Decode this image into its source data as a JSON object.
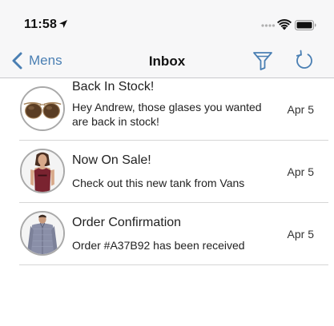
{
  "status_bar": {
    "time": "11:58",
    "icons": [
      "location-arrow-icon",
      "cellular-signal-icon",
      "wifi-icon",
      "battery-icon"
    ]
  },
  "nav": {
    "back_label": "Mens",
    "title": "Inbox",
    "actions": [
      "filter-icon",
      "refresh-icon"
    ]
  },
  "colors": {
    "accent": "#4a7fb3",
    "nav_background": "#f7f7f8",
    "separator": "#d6d6d6"
  },
  "messages": [
    {
      "title": "Back In Stock!",
      "body": "Hey Andrew, those glases you wanted are back in stock!",
      "date": "Apr 5",
      "image": "sunglasses"
    },
    {
      "title": "Now On Sale!",
      "body": "Check out this new tank from Vans",
      "date": "Apr 5",
      "image": "tank-top-model"
    },
    {
      "title": "Order Confirmation",
      "body": "Order #A37B92 has been received",
      "date": "Apr 5",
      "image": "shirt-model"
    }
  ]
}
